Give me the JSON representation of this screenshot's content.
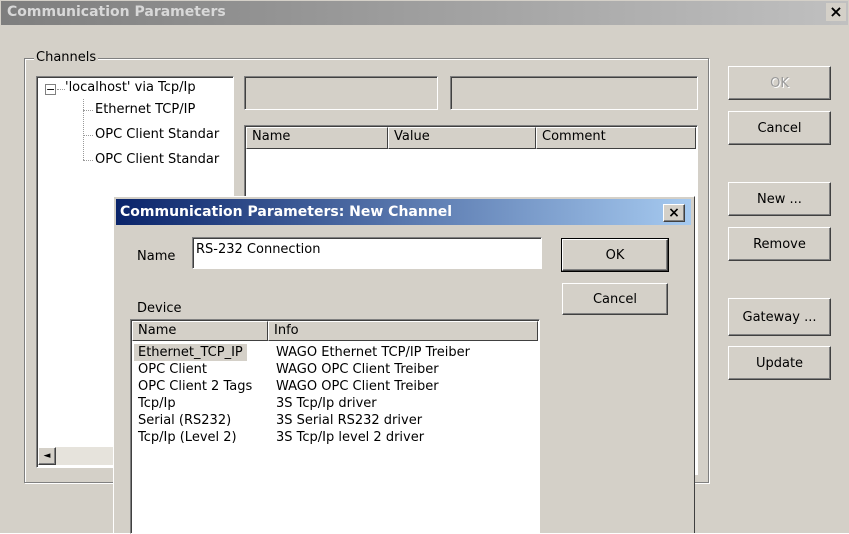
{
  "main_window": {
    "title": "Communication Parameters",
    "close_glyph": "×",
    "channels_label": "Channels",
    "tree": {
      "root": "'localhost' via Tcp/Ip",
      "expander": "−",
      "children": [
        "Ethernet TCP/IP",
        "OPC Client Standar",
        "OPC Client Standar"
      ]
    },
    "param_columns": [
      "Name",
      "Value",
      "Comment"
    ],
    "buttons": {
      "ok": "OK",
      "cancel": "Cancel",
      "new": "New ...",
      "remove": "Remove",
      "gateway": "Gateway ...",
      "update": "Update"
    },
    "scroll_left_glyph": "◄"
  },
  "dialog": {
    "title": "Communication Parameters: New Channel",
    "close_glyph": "×",
    "name_label": "Name",
    "name_value": "RS-232 Connection",
    "device_label": "Device",
    "ok_label": "OK",
    "cancel_label": "Cancel",
    "device_columns": [
      "Name",
      "Info"
    ],
    "devices": [
      {
        "name": "Ethernet_TCP_IP",
        "info": "WAGO Ethernet TCP/IP Treiber"
      },
      {
        "name": "OPC Client",
        "info": "WAGO OPC Client Treiber"
      },
      {
        "name": "OPC Client 2 Tags",
        "info": "WAGO OPC Client Treiber"
      },
      {
        "name": "Tcp/Ip",
        "info": "3S Tcp/Ip driver"
      },
      {
        "name": "Serial (RS232)",
        "info": "3S Serial RS232 driver"
      },
      {
        "name": "Tcp/Ip (Level 2)",
        "info": "3S Tcp/Ip level 2 driver"
      }
    ],
    "selected_index": 0
  },
  "colors": {
    "active_title_start": "#0a246a",
    "active_title_end": "#a6caf0",
    "inactive_title": "#808080",
    "face": "#d4d0c8"
  }
}
